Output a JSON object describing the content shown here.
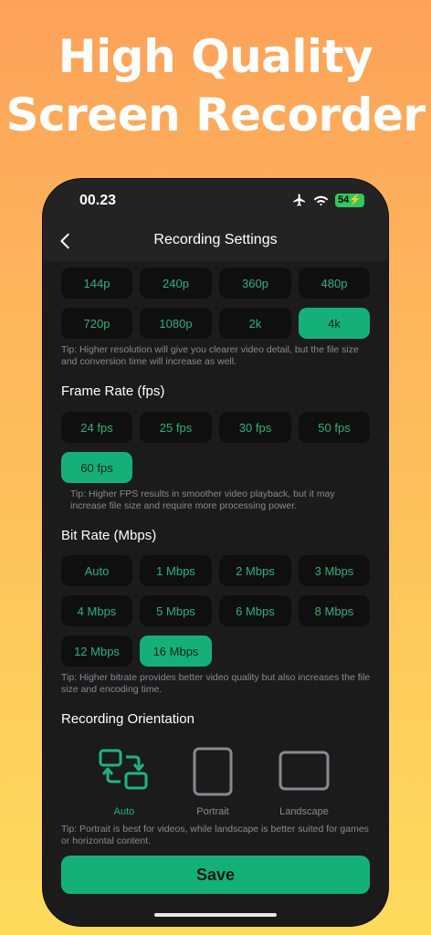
{
  "headline": {
    "line1": "High Quality",
    "line2": "Screen Recorder"
  },
  "status_bar": {
    "time": "00.23",
    "battery": "54"
  },
  "nav": {
    "title": "Recording Settings"
  },
  "resolution": {
    "options": [
      "144p",
      "240p",
      "360p",
      "480p",
      "720p",
      "1080p",
      "2k",
      "4k"
    ],
    "selected": "4k",
    "tip": "Tip: Higher resolution will give you clearer video detail, but the file size and conversion time will increase as well."
  },
  "frame_rate": {
    "title": "Frame Rate (fps)",
    "options": [
      "24 fps",
      "25 fps",
      "30 fps",
      "50 fps",
      "60 fps"
    ],
    "selected": "60 fps",
    "tip": "Tip: Higher FPS results in smoother video playback, but it may increase file size and require more processing power."
  },
  "bit_rate": {
    "title": "Bit Rate (Mbps)",
    "options": [
      "Auto",
      "1 Mbps",
      "2 Mbps",
      "3 Mbps",
      "4 Mbps",
      "5 Mbps",
      "6 Mbps",
      "8 Mbps",
      "12 Mbps",
      "16 Mbps"
    ],
    "selected": "16 Mbps",
    "tip": "Tip: Higher bitrate provides better video quality but also increases the file size and encoding time."
  },
  "orientation": {
    "title": "Recording Orientation",
    "options": [
      "Auto",
      "Portrait",
      "Landscape"
    ],
    "selected": "Auto",
    "tip": "Tip: Portrait is best for videos, while landscape is better suited for games or horizontal content."
  },
  "save_label": "Save",
  "colors": {
    "accent": "#15b07a",
    "background": "#1b1b1c",
    "option_bg": "#0f0f0f"
  }
}
